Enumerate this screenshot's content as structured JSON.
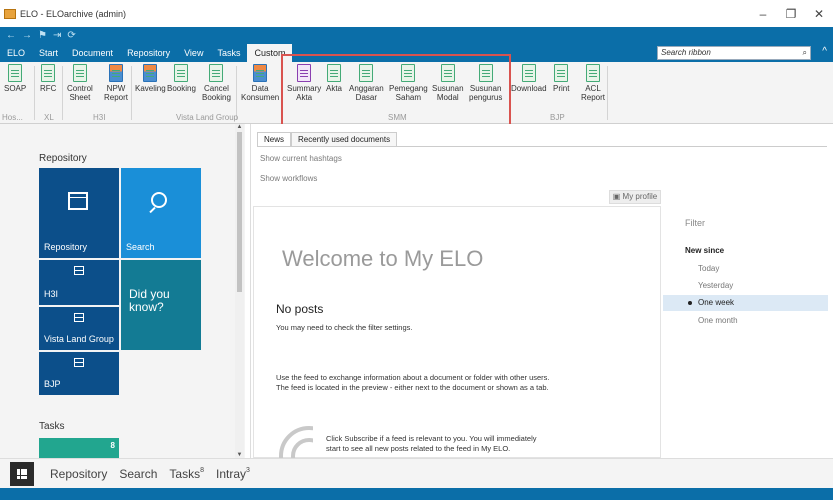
{
  "window": {
    "title": "ELO - ELOarchive (admin)"
  },
  "tabs": [
    "ELO",
    "Start",
    "Document",
    "Repository",
    "View",
    "Tasks",
    "Custom"
  ],
  "ribbon_search_placeholder": "Search ribbon",
  "ribbon_buttons": {
    "soap": "SOAP",
    "rfc": "RFC",
    "control_sheet": "Control\nSheet",
    "npw_report": "NPW\nReport",
    "kaveling": "Kaveling",
    "booking": "Booking",
    "cancel_booking": "Cancel\nBooking",
    "data_konsumen": "Data\nKonsumen",
    "summary_akta": "Summary\nAkta",
    "akta": "Akta",
    "anggaran_dasar": "Anggaran\nDasar",
    "pemegang_saham": "Pemegang\nSaham",
    "susunan_modal": "Susunan\nModal",
    "susunan_pengurus": "Susunan\npengurus",
    "download": "Download",
    "print": "Print",
    "acl_report": "ACL\nReport"
  },
  "ribbon_groups": {
    "hos": "Hos...",
    "xl": "XL",
    "h3i": "H3I",
    "vista": "Vista Land Group",
    "smm": "SMM",
    "bjp": "BJP"
  },
  "left": {
    "repository_title": "Repository",
    "tiles": {
      "repository": "Repository",
      "search": "Search",
      "h3i": "H3I",
      "did_you_know": "Did you\nknow?",
      "vista": "Vista Land Group",
      "bjp": "BJP"
    },
    "tasks_title": "Tasks",
    "tasks_count": "8"
  },
  "main": {
    "tabs": [
      "News",
      "Recently used documents"
    ],
    "show_hashtags": "Show current hashtags",
    "show_workflows": "Show workflows",
    "my_profile": "My profile",
    "welcome": "Welcome to My ELO",
    "no_posts": "No posts",
    "filter_hint": "You may need to check the filter settings.",
    "feed_info_1": "Use the feed to exchange information about a document or folder with other users.",
    "feed_info_2": "The feed is located in the preview - either next to the document or shown as a tab.",
    "subscribe_1": "Click Subscribe if a feed is relevant to you. You will immediately",
    "subscribe_2": "start to see all new posts related to the feed in My ELO."
  },
  "filter": {
    "title": "Filter",
    "new_since": "New since",
    "options": [
      "Today",
      "Yesterday",
      "One week",
      "One month"
    ],
    "selected": "One week"
  },
  "bottom_nav": {
    "repository": "Repository",
    "search": "Search",
    "tasks": "Tasks",
    "tasks_count": "8",
    "intray": "Intray",
    "intray_count": "3"
  }
}
